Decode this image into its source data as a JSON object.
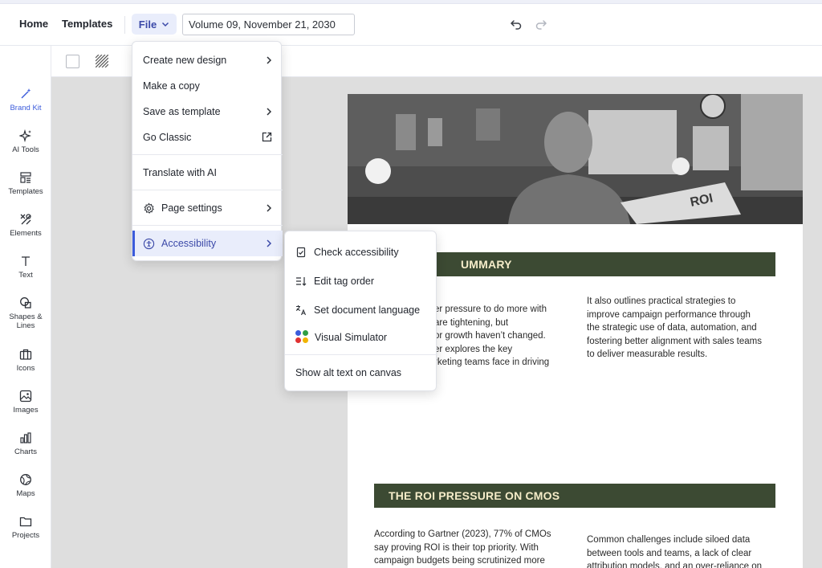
{
  "header": {
    "home_label": "Home",
    "templates_label": "Templates",
    "file_label": "File",
    "document_title": "Volume 09, November 21, 2030"
  },
  "sidebar": {
    "items": [
      {
        "label": "Brand Kit",
        "icon": "magic-wand-icon"
      },
      {
        "label": "AI Tools",
        "icon": "sparkle-icon"
      },
      {
        "label": "Templates",
        "icon": "templates-icon"
      },
      {
        "label": "Elements",
        "icon": "elements-icon"
      },
      {
        "label": "Text",
        "icon": "text-icon"
      },
      {
        "label": "Shapes &",
        "label2": "Lines",
        "icon": "shapes-icon"
      },
      {
        "label": "Icons",
        "icon": "briefcase-icon"
      },
      {
        "label": "Images",
        "icon": "image-icon"
      },
      {
        "label": "Charts",
        "icon": "chart-icon"
      },
      {
        "label": "Maps",
        "icon": "globe-icon"
      },
      {
        "label": "Projects",
        "icon": "folder-icon"
      }
    ]
  },
  "file_menu": {
    "items": [
      {
        "label": "Create new design"
      },
      {
        "label": "Make a copy"
      },
      {
        "label": "Save as template"
      },
      {
        "label": "Go Classic"
      },
      {
        "label": "Translate with AI"
      },
      {
        "label": "Page settings"
      },
      {
        "label": "Accessibility"
      }
    ]
  },
  "accessibility_menu": {
    "items": [
      {
        "label": "Check accessibility"
      },
      {
        "label": "Edit tag order"
      },
      {
        "label": "Set document language"
      },
      {
        "label": "Visual Simulator"
      },
      {
        "label": "Show alt text on canvas"
      }
    ]
  },
  "document": {
    "section1_title": "UMMARY",
    "section1_col1": [
      "er pressure to do more with",
      "are tightening, but",
      "or growth haven’t changed.",
      "er explores the key",
      "rketing teams face in driving"
    ],
    "section1_col2": [
      "It also outlines practical strategies to",
      "improve campaign performance through",
      "the strategic use of data, automation, and",
      "fostering better alignment with sales teams",
      "to deliver measurable results."
    ],
    "section2_title": "THE ROI PRESSURE ON CMOS",
    "section2_col1": [
      "According to Gartner (2023), 77% of CMOs",
      "say proving ROI is their top priority. With",
      "campaign budgets being scrutinized more"
    ],
    "section2_col2": [
      "Common challenges include siloed data",
      "between tools and teams, a lack of clear",
      "attribution models, and an over-reliance on"
    ],
    "hero_sign": "ROI"
  },
  "colors": {
    "accent": "#3b5bdb",
    "banner": "#3c4a33",
    "banner_text": "#f5ecc9"
  }
}
